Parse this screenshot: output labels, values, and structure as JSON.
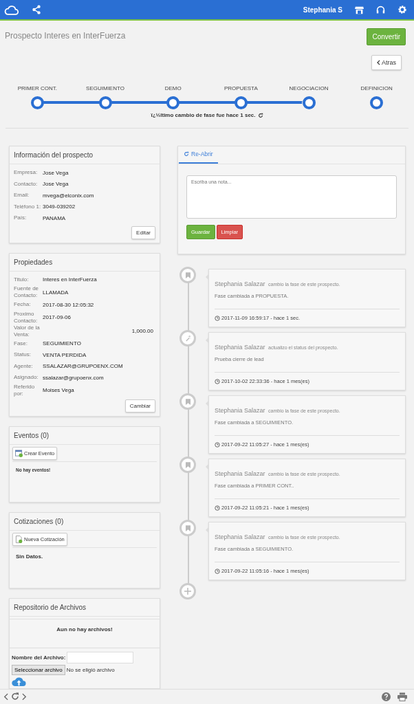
{
  "header": {
    "user": "Stephania S"
  },
  "page": {
    "title": "Prospecto Interes en InterFuerza",
    "convert_button": "Convertir",
    "back_button": "Atras"
  },
  "stages": [
    {
      "label": "PRIMER CONT.",
      "reached": true
    },
    {
      "label": "SEGUIMIENTO",
      "reached": true
    },
    {
      "label": "DEMO",
      "reached": true
    },
    {
      "label": "PROPUESTA",
      "reached": true
    },
    {
      "label": "NEGOCIACION",
      "reached": false
    },
    {
      "label": "DEFINICION",
      "reached": false
    }
  ],
  "last_change": "ï¿½ltimo cambio de fase fue hace 1 sec.",
  "prospect_info": {
    "title": "Información del prospecto",
    "rows": [
      {
        "label": "Empresa:",
        "value": "Jose Vega"
      },
      {
        "label": "Contacto:",
        "value": "Jose Vega"
      },
      {
        "label": "Email:",
        "value": "mvega@elconix.com"
      },
      {
        "label": "Teléfono 1:",
        "value": "3049-039202"
      },
      {
        "label": "País:",
        "value": "PANAMA"
      }
    ],
    "button": "Editar"
  },
  "properties": {
    "title": "Propiedades",
    "rows": [
      {
        "label": "Titulo:",
        "value": "Interes en InterFuerza",
        "kind": "text"
      },
      {
        "label": "Fuente de Contacto:",
        "value": "LLAMADA",
        "kind": "text"
      },
      {
        "label": "Fecha:",
        "value": "2017-08-30 12:05:32",
        "kind": "text"
      },
      {
        "label": "Proximo Contacto:",
        "value": "2017-09-06",
        "kind": "text"
      },
      {
        "label": "Valor de la Venta:",
        "value": "1,000.00",
        "kind": "amount"
      },
      {
        "label": "Fase:",
        "value": "SEGUIMIENTO",
        "kind": "text"
      },
      {
        "label": "Status:",
        "value": "VENTA PERDIDA",
        "kind": "text"
      },
      {
        "label": "Agente:",
        "value": "SSALAZAR@GRUPOENX.COM",
        "kind": "text"
      },
      {
        "label": "Asignado:",
        "value": "ssalazar@grupoenx.com",
        "kind": "text"
      },
      {
        "label": "Referido por:",
        "value": "Moises Vega",
        "kind": "text"
      }
    ],
    "button": "Cambiar"
  },
  "events": {
    "title": "Eventos (0)",
    "button": "Crear Evento",
    "empty": "No hay eventos!"
  },
  "quotes": {
    "title": "Cotizaciones (0)",
    "button": "Nueva Cotización",
    "empty": "Sin Datos."
  },
  "files": {
    "title": "Repositorio de Archivos",
    "empty": "Aun no hay archivos!",
    "name_label": "Nombre del Archivo:",
    "select_button": "Seleccionar archivo",
    "no_file": "No se eligió archivo"
  },
  "note": {
    "tab": "Re-Abrir",
    "placeholder": "Escriba una nota...",
    "save": "Guardar",
    "clear": "Limpiar"
  },
  "timeline": [
    {
      "kind": "phase",
      "author": "Stephania Salazar",
      "action": "cambio la fase de este prospecto.",
      "message": "Fase cambiada a PROPUESTA.",
      "time": "2017-11-09 16:59:17 - hace 1 sec."
    },
    {
      "kind": "status",
      "author": "Stephania Salazar",
      "action": "actualizo el status del prospecto.",
      "message": "Prueba cierre de lead",
      "time": "2017-10-02 22:33:36 - hace 1 mes(es)"
    },
    {
      "kind": "phase",
      "author": "Stephania Salazar",
      "action": "cambio la fase de este prospecto.",
      "message": "Fase cambiada a SEGUIMIENTO.",
      "time": "2017-09-22 11:05:27 - hace 1 mes(es)"
    },
    {
      "kind": "phase",
      "author": "Stephania Salazar",
      "action": "cambio la fase de este prospecto.",
      "message": "Fase cambiada a PRIMER CONT..",
      "time": "2017-09-22 11:05:21 - hace 1 mes(es)"
    },
    {
      "kind": "phase",
      "author": "Stephania Salazar",
      "action": "cambio la fase de este prospecto.",
      "message": "Fase cambiada a SEGUIMIENTO.",
      "time": "2017-09-22 11:05:16 - hace 1 mes(es)"
    }
  ]
}
